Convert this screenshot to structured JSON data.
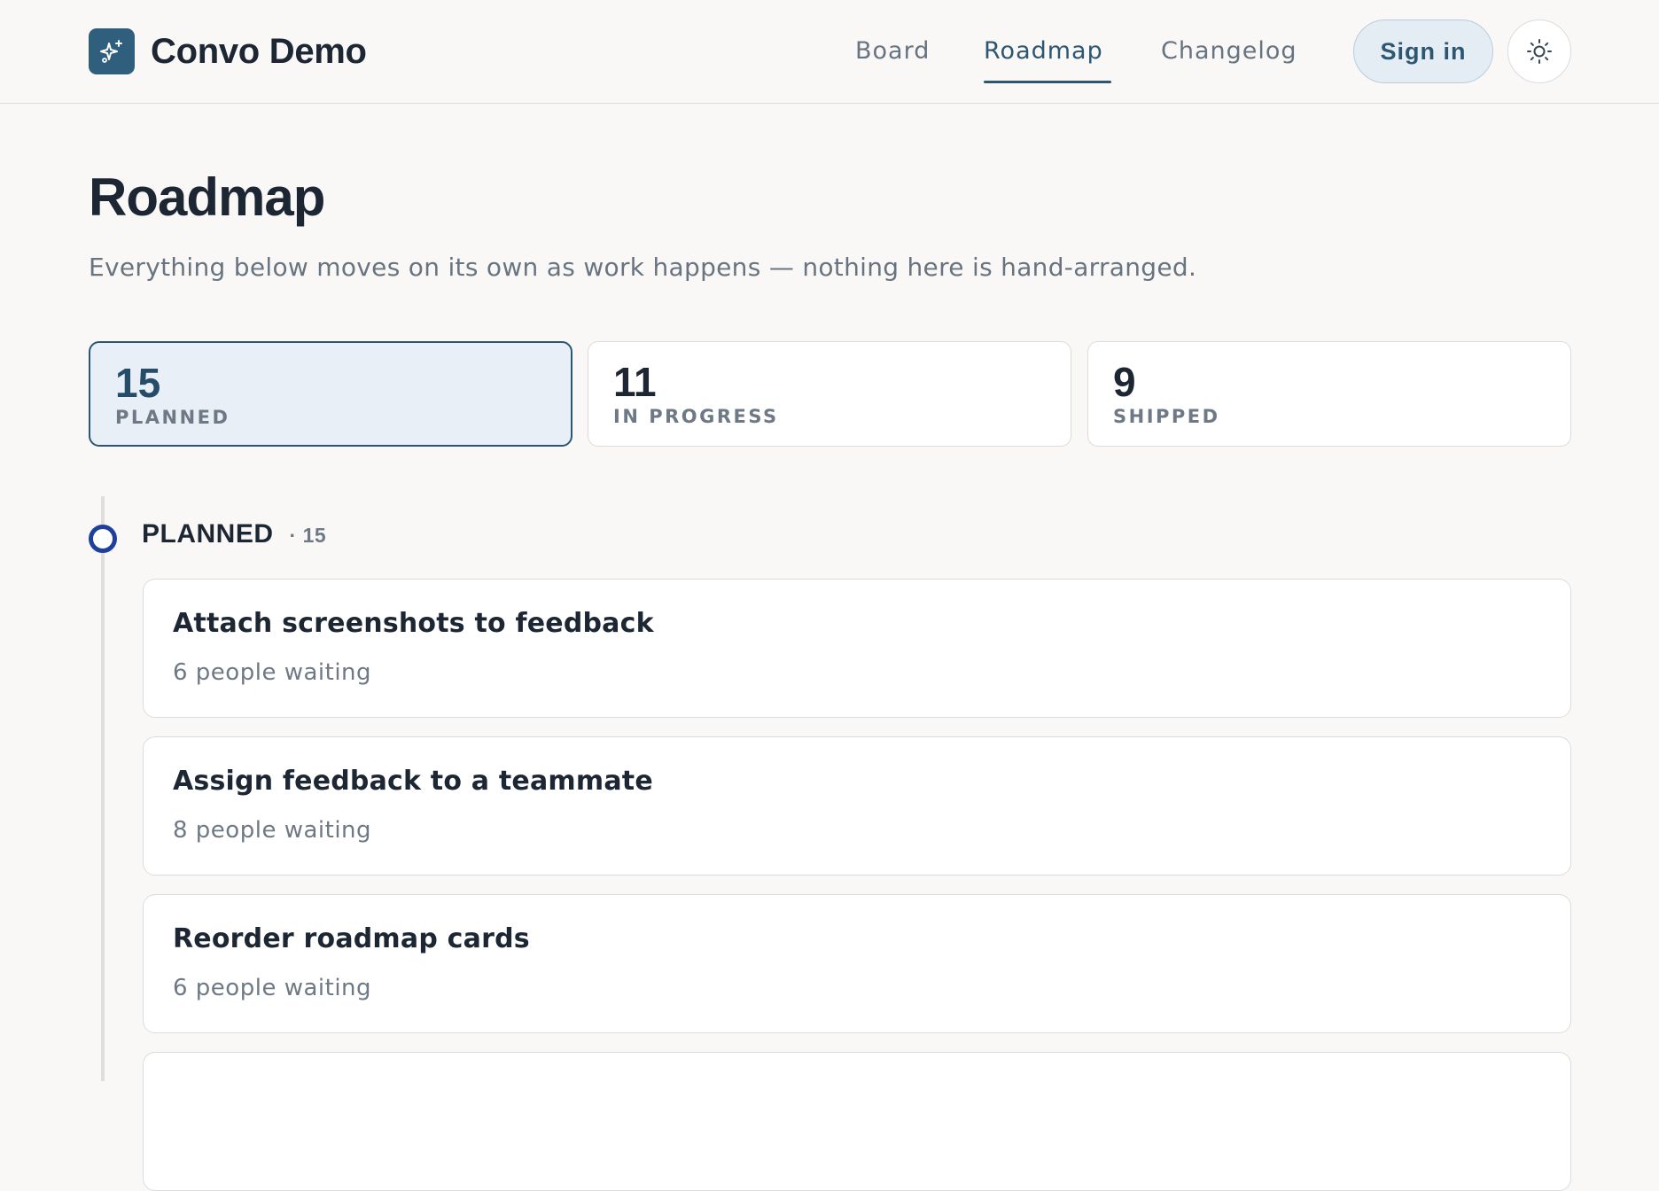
{
  "header": {
    "brand_name": "Convo Demo",
    "brand_icon": "sparkles-icon",
    "nav": [
      {
        "label": "Board",
        "active": false
      },
      {
        "label": "Roadmap",
        "active": true
      },
      {
        "label": "Changelog",
        "active": false
      }
    ],
    "sign_in_label": "Sign in",
    "theme_icon": "sun-icon"
  },
  "page": {
    "title": "Roadmap",
    "subtitle": "Everything below moves on its own as work happens — nothing here is hand-arranged."
  },
  "stats": [
    {
      "count": "15",
      "label": "PLANNED",
      "selected": true
    },
    {
      "count": "11",
      "label": "IN PROGRESS",
      "selected": false
    },
    {
      "count": "9",
      "label": "SHIPPED",
      "selected": false
    }
  ],
  "group": {
    "title": "PLANNED",
    "count": "· 15",
    "items": [
      {
        "title": "Attach screenshots to feedback",
        "meta": "6 people waiting"
      },
      {
        "title": "Assign feedback to a teammate",
        "meta": "8 people waiting"
      },
      {
        "title": "Reorder roadmap cards",
        "meta": "6 people waiting"
      },
      {
        "title": "",
        "meta": ""
      }
    ]
  },
  "colors": {
    "accent": "#2c5671",
    "timeline_dot": "#1f3f9c",
    "background": "#f9f8f6"
  }
}
